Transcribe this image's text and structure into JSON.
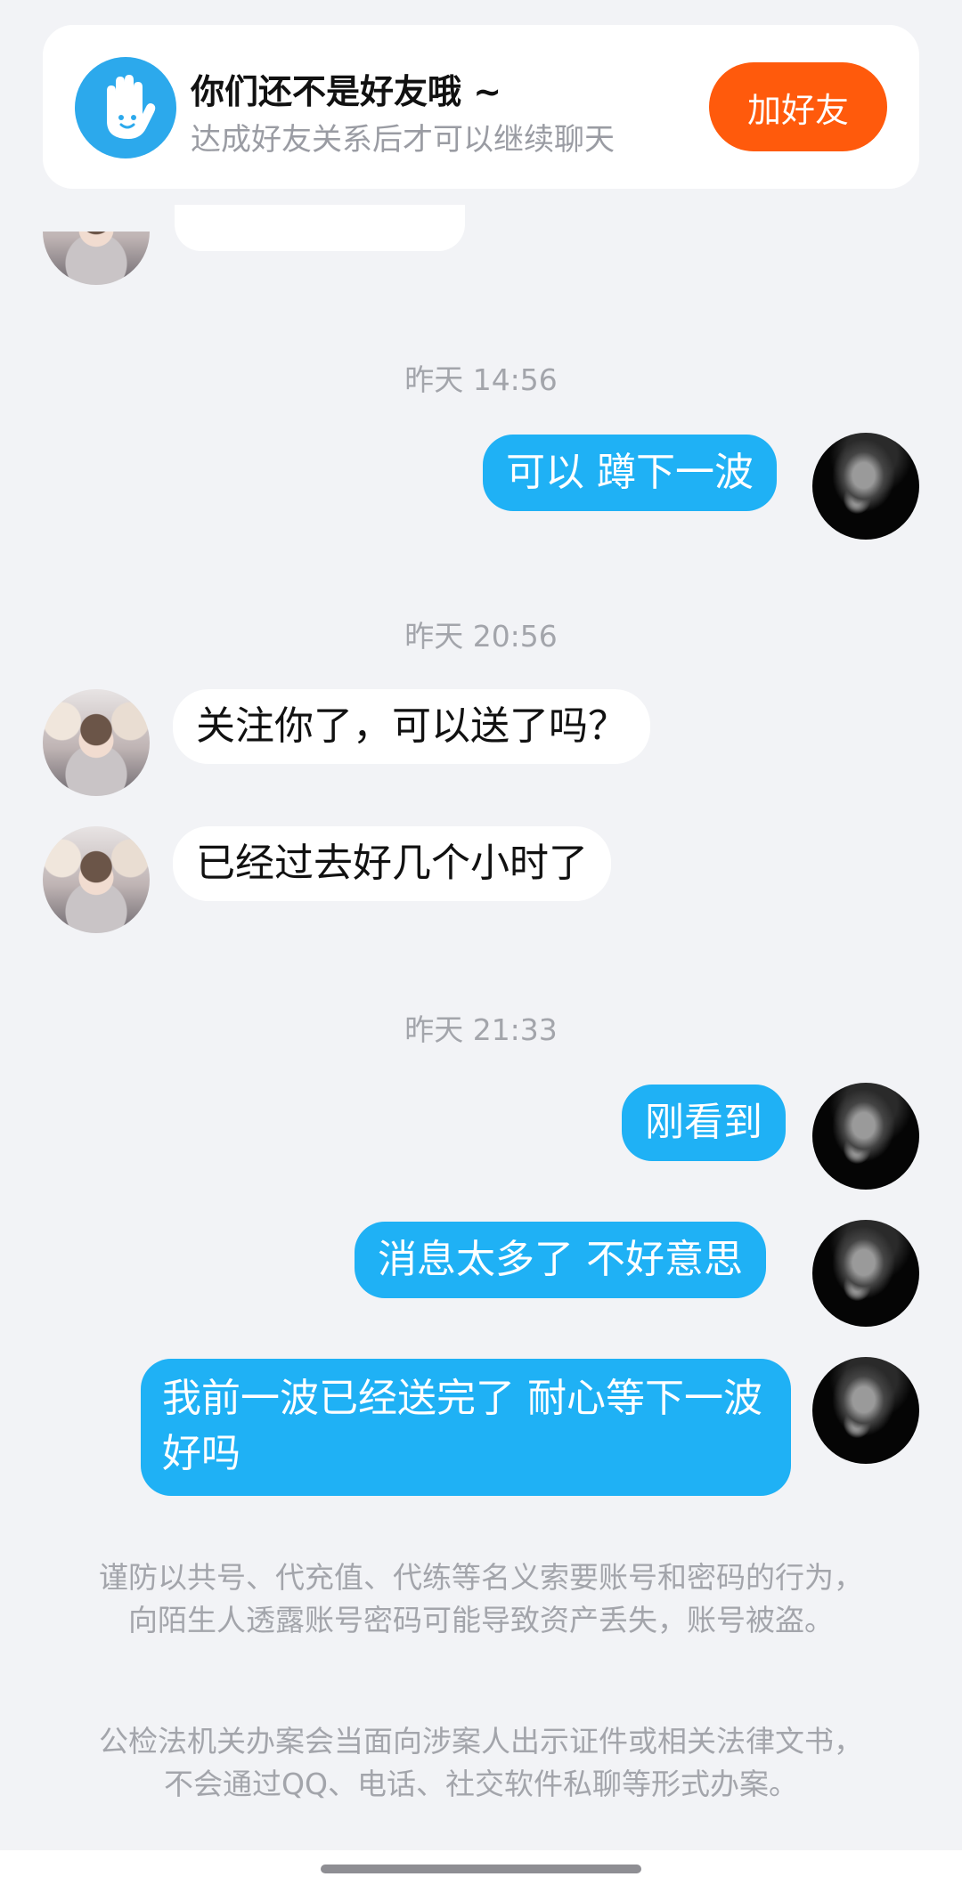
{
  "banner": {
    "icon": "hand-wave-icon",
    "title": "你们还不是好友哦 ~",
    "subtitle": "达成好友关系后才可以继续聊天",
    "add_friend_label": "加好友",
    "accent_color": "#ff5a0c",
    "icon_bg": "#2ca9ec"
  },
  "timestamps": [
    "昨天 14:56",
    "昨天 20:56",
    "昨天 21:33"
  ],
  "messages": {
    "m1": "可以 蹲下一波",
    "m2": "关注你了，可以送了吗？",
    "m3": "已经过去好几个小时了",
    "m4": "刚看到",
    "m5": "消息太多了 不好意思",
    "m6": "我前一波已经送完了 耐心等下一波好吗"
  },
  "notices": [
    "谨防以共号、代充值、代练等名义索要账号和密码的行为，向陌生人透露账号密码可能导致资产丢失，账号被盗。",
    "公检法机关办案会当面向涉案人出示证件或相关法律文书，不会通过QQ、电话、社交软件私聊等形式办案。"
  ],
  "colors": {
    "self_bubble": "#1fb1f5",
    "peer_bubble": "#ffffff",
    "background": "#f2f3f6"
  }
}
